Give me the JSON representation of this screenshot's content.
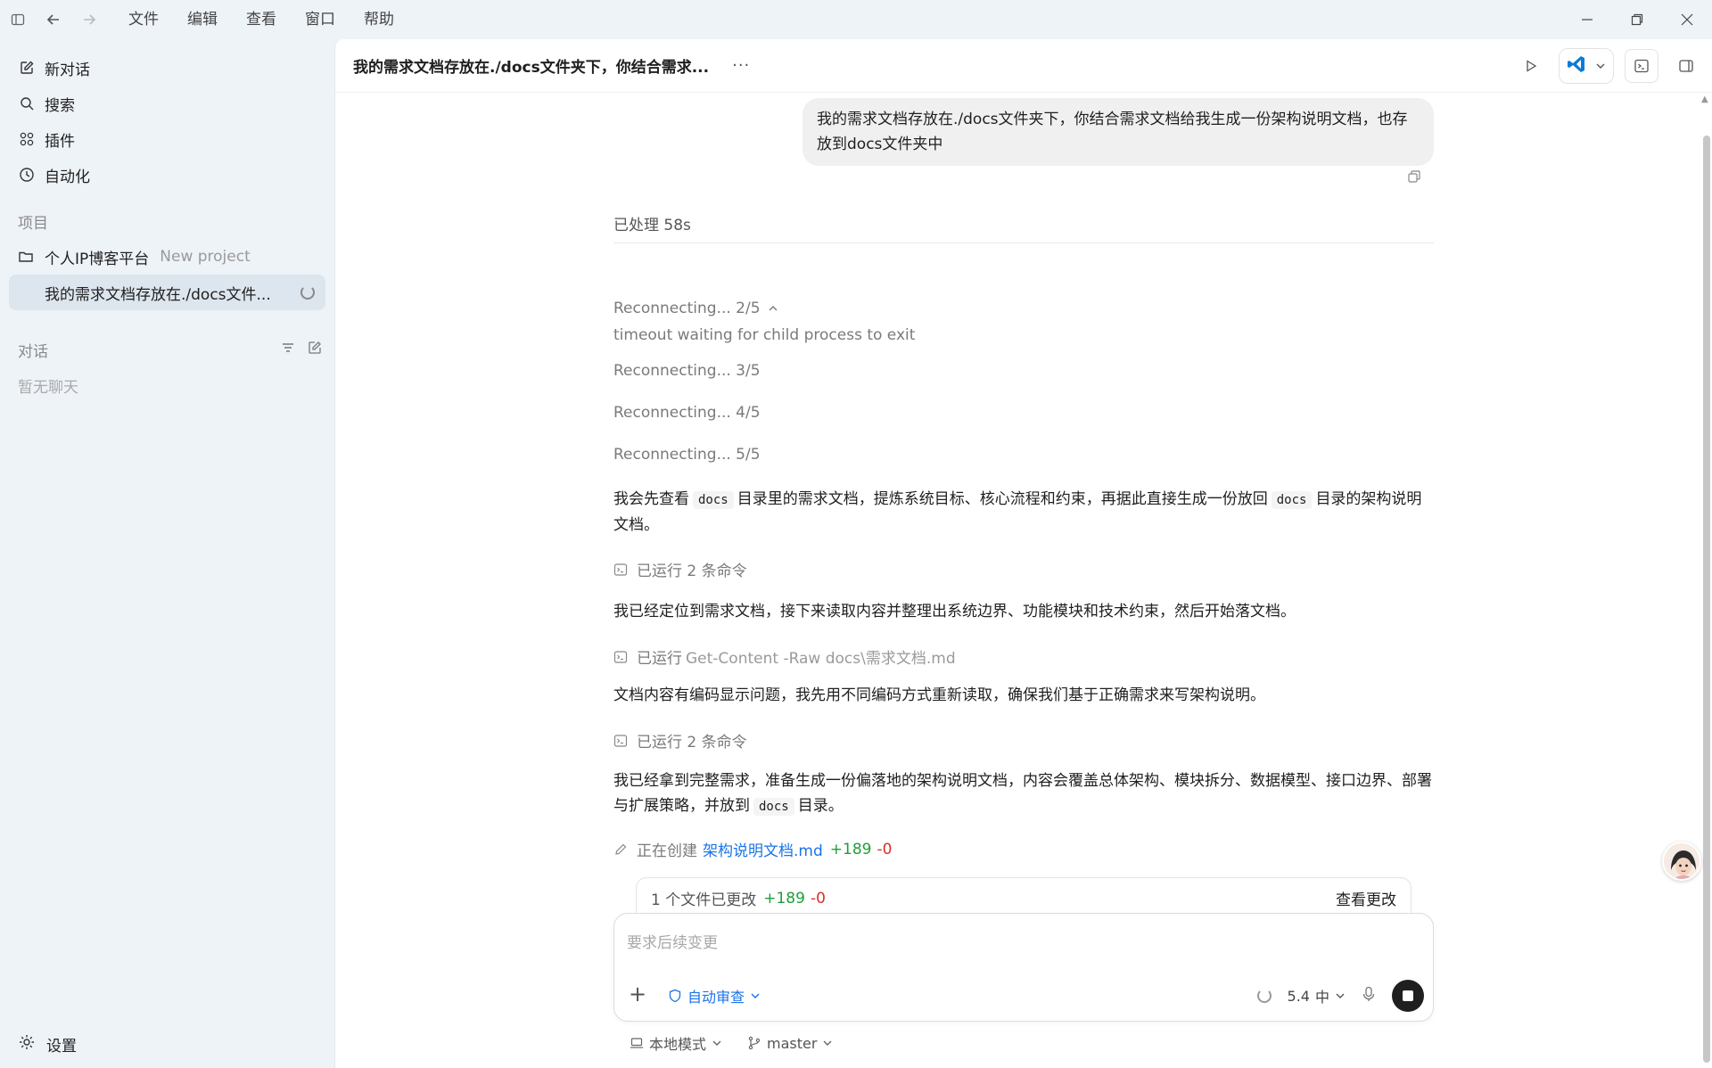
{
  "menu": [
    "文件",
    "编辑",
    "查看",
    "窗口",
    "帮助"
  ],
  "sidebar": {
    "new_chat": "新对话",
    "search": "搜索",
    "plugins": "插件",
    "automation": "自动化",
    "projects_label": "项目",
    "project_name": "个人IP博客平台",
    "project_sub": "New project",
    "active_thread": "我的需求文档存放在./docs文件...",
    "conversations_label": "对话",
    "empty": "暂无聊天",
    "settings": "设置"
  },
  "header": {
    "title": "我的需求文档存放在./docs文件夹下，你结合需求...",
    "more": "···"
  },
  "chat": {
    "user_message": "我的需求文档存放在./docs文件夹下，你结合需求文档给我生成一份架构说明文档，也存放到docs文件夹中",
    "processed": "已处理 58s",
    "reconnect_2": "Reconnecting... 2/5",
    "timeout": "timeout waiting for child process to exit",
    "reconnect_3": "Reconnecting... 3/5",
    "reconnect_4": "Reconnecting... 4/5",
    "reconnect_5": "Reconnecting... 5/5",
    "msg1_a": "我会先查看",
    "msg1_code1": "docs",
    "msg1_b": "目录里的需求文档，提炼系统目标、核心流程和约束，再据此直接生成一份放回",
    "msg1_code2": "docs",
    "msg1_c": "目录的架构说明文档。",
    "ran1": "已运行 2 条命令",
    "msg2": "我已经定位到需求文档，接下来读取内容并整理出系统边界、功能模块和技术约束，然后开始落文档。",
    "ran_single": "已运行",
    "ran_single_arg": "Get-Content -Raw docs\\需求文档.md",
    "msg3": "文档内容有编码显示问题，我先用不同编码方式重新读取，确保我们基于正确需求来写架构说明。",
    "ran2": "已运行 2 条命令",
    "msg4_a": "我已经拿到完整需求，准备生成一份偏落地的架构说明文档，内容会覆盖总体架构、模块拆分、数据模型、接口边界、部署与扩展策略，并放到",
    "msg4_code": "docs",
    "msg4_b": "目录。",
    "creating": "正在创建",
    "file_name": "架构说明文档.md",
    "additions": "+189",
    "deletions": "-0"
  },
  "changes": {
    "summary": "1 个文件已更改",
    "additions": "+189",
    "deletions": "-0",
    "view": "查看更改"
  },
  "composer": {
    "placeholder": "要求后续变更",
    "review": "自动审查",
    "model": "5.4",
    "effort": "中"
  },
  "footer": {
    "mode": "本地模式",
    "branch": "master"
  }
}
